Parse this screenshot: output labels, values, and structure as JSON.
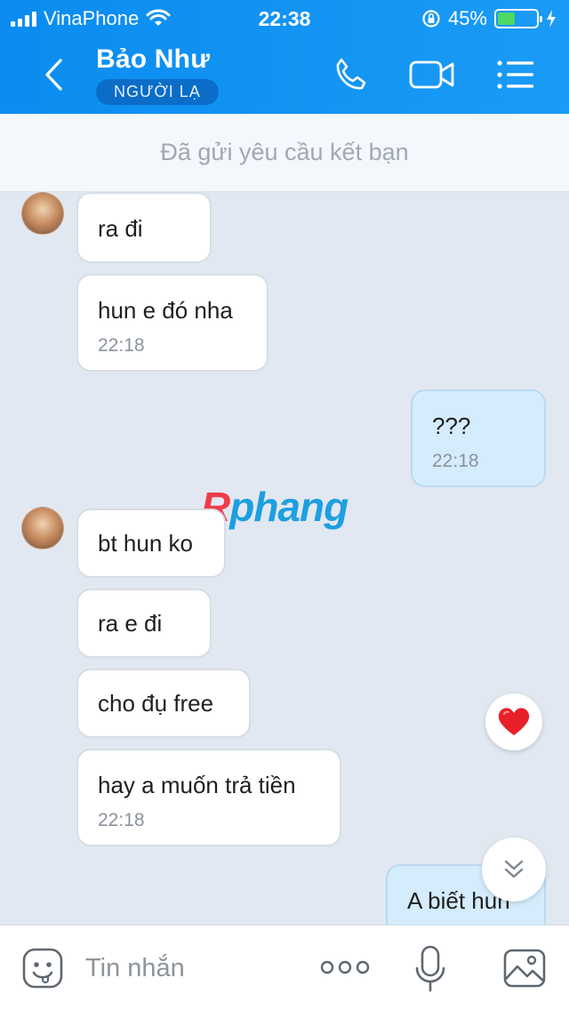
{
  "status_bar": {
    "carrier": "VinaPhone",
    "time": "22:38",
    "battery_percent": "45%",
    "battery_level": 0.45,
    "battery_fill_color": "#4cd964"
  },
  "header": {
    "contact_name": "Bảo Như",
    "badge": "NGƯỜI LẠ",
    "icons": [
      "back-chevron-icon",
      "phone-icon",
      "video-camera-icon",
      "menu-list-icon"
    ],
    "background_color": "#0a8cf0"
  },
  "friend_request": {
    "text": "Đã gửi yêu cầu kết bạn"
  },
  "watermark": {
    "first": "R",
    "rest": "phang"
  },
  "messages": [
    {
      "sender": "them",
      "text": "ra đi"
    },
    {
      "sender": "them",
      "text": "hun e đó nha",
      "time": "22:18"
    },
    {
      "sender": "me",
      "text": "???",
      "time": "22:18"
    },
    {
      "sender": "them",
      "text": "bt hun ko"
    },
    {
      "sender": "them",
      "text": "ra e đi"
    },
    {
      "sender": "them",
      "text": "cho đụ free"
    },
    {
      "sender": "them",
      "text": "hay a muốn trả tiền",
      "time": "22:18"
    },
    {
      "sender": "me",
      "text": "A biết hun"
    }
  ],
  "input_bar": {
    "placeholder": "Tin nhắn",
    "icons": [
      "sticker-face-icon",
      "more-dots-icon",
      "microphone-icon",
      "image-gallery-icon"
    ]
  },
  "floating": {
    "icons": [
      "heart-reaction-icon",
      "scroll-down-icon"
    ],
    "heart_color": "#e8202a"
  }
}
